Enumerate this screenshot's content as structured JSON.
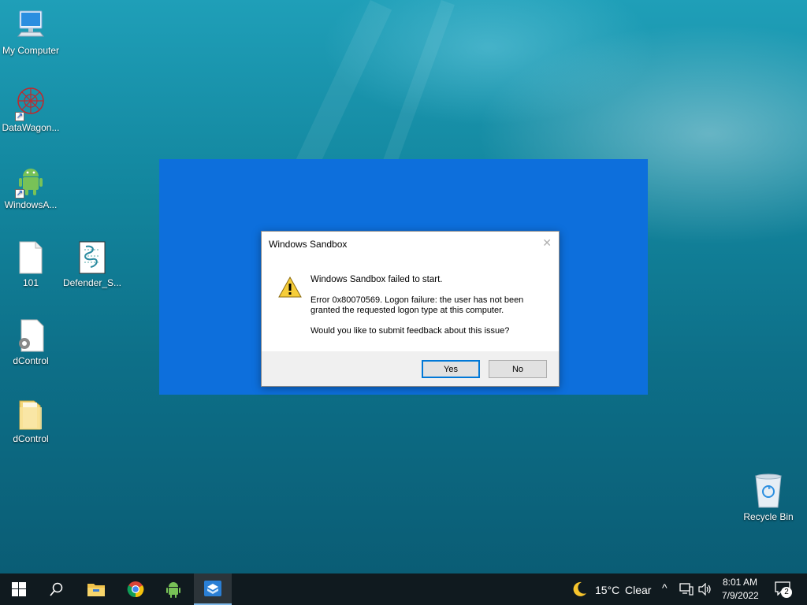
{
  "desktop": {
    "icons": [
      {
        "label": "My Computer"
      },
      {
        "label": "DataWagon..."
      },
      {
        "label": "WindowsA..."
      },
      {
        "label": "101"
      },
      {
        "label": "Defender_S..."
      },
      {
        "label": "dControl"
      },
      {
        "label": "dControl"
      }
    ],
    "recycle_bin": {
      "label": "Recycle Bin"
    }
  },
  "dialog": {
    "title": "Windows Sandbox",
    "heading": "Windows Sandbox failed to start.",
    "error_message": "Error 0x80070569. Logon failure: the user has not been granted the requested logon type at this computer.",
    "question": "Would you like to submit feedback about this issue?",
    "yes_label": "Yes",
    "no_label": "No",
    "icon": "warning-icon"
  },
  "taskbar": {
    "apps": [
      "start-icon",
      "search-icon",
      "file-explorer-icon",
      "chrome-icon",
      "android-icon",
      "sandbox-icon"
    ],
    "weather": {
      "temp": "15°C",
      "condition": "Clear",
      "icon": "moon-icon"
    },
    "clock": {
      "time": "8:01 AM",
      "date": "7/9/2022"
    },
    "notifications": {
      "count": "2"
    }
  },
  "colors": {
    "sandbox_blue": "#0d6fdc",
    "taskbar": "#101a1f",
    "accent": "#0078d7"
  }
}
